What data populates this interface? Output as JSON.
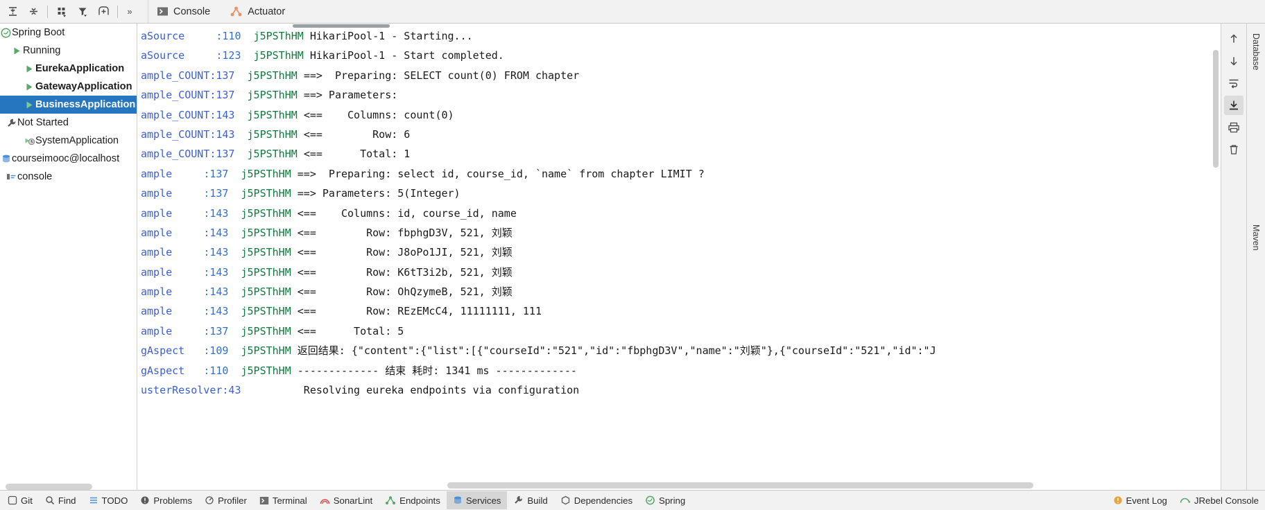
{
  "window": {
    "title": "Services"
  },
  "toolbar": {
    "buttons": [
      {
        "name": "expand-all-icon",
        "tooltip": "Expand All"
      },
      {
        "name": "collapse-all-icon",
        "tooltip": "Collapse All"
      },
      {
        "name": "group-by-icon",
        "tooltip": "Group By"
      },
      {
        "name": "filter-icon",
        "tooltip": "Filter"
      },
      {
        "name": "add-service-icon",
        "tooltip": "Add Service"
      }
    ],
    "more_label": "»"
  },
  "tabs": [
    {
      "label": "Console",
      "icon": "console-icon",
      "active": true
    },
    {
      "label": "Actuator",
      "icon": "actuator-icon",
      "active": false
    }
  ],
  "sidebar": {
    "items": [
      {
        "label": "Spring Boot",
        "indent": 0,
        "icon": "spring-boot-icon",
        "bold": false,
        "selected": false
      },
      {
        "label": "Running",
        "indent": 1,
        "icon": "run-arrow-icon",
        "bold": false,
        "selected": false
      },
      {
        "label": "EurekaApplication",
        "indent": 2,
        "icon": "run-arrow-icon",
        "bold": true,
        "selected": false
      },
      {
        "label": "GatewayApplication",
        "indent": 2,
        "icon": "run-arrow-icon",
        "bold": true,
        "selected": false
      },
      {
        "label": "BusinessApplication",
        "indent": 2,
        "icon": "run-arrow-icon",
        "bold": true,
        "selected": true
      },
      {
        "label": "Not Started",
        "indent": 1,
        "icon": "wrench-icon",
        "bold": false,
        "selected": false
      },
      {
        "label": "SystemApplication",
        "indent": 2,
        "icon": "not-started-icon",
        "bold": false,
        "selected": false
      },
      {
        "label": "courseimooc@localhost",
        "indent": 0,
        "icon": "database-icon",
        "bold": false,
        "selected": false
      },
      {
        "label": "console",
        "indent": 1,
        "icon": "db-console-icon",
        "bold": false,
        "selected": false
      }
    ]
  },
  "console": {
    "lines": [
      {
        "src": "aSource",
        "line": ":110",
        "thread": "j5PSThHM",
        "msg": "HikariPool-1 - Starting..."
      },
      {
        "src": "aSource",
        "line": ":123",
        "thread": "j5PSThHM",
        "msg": "HikariPool-1 - Start completed."
      },
      {
        "src": "ample_COUNT:137",
        "line": "",
        "thread": "j5PSThHM",
        "msg": "==>  Preparing: SELECT count(0) FROM chapter"
      },
      {
        "src": "ample_COUNT:137",
        "line": "",
        "thread": "j5PSThHM",
        "msg": "==> Parameters:"
      },
      {
        "src": "ample_COUNT:143",
        "line": "",
        "thread": "j5PSThHM",
        "msg": "<==    Columns: count(0)"
      },
      {
        "src": "ample_COUNT:143",
        "line": "",
        "thread": "j5PSThHM",
        "msg": "<==        Row: 6"
      },
      {
        "src": "ample_COUNT:137",
        "line": "",
        "thread": "j5PSThHM",
        "msg": "<==      Total: 1"
      },
      {
        "src": "ample",
        "line": ":137",
        "thread": "j5PSThHM",
        "msg": "==>  Preparing: select id, course_id, `name` from chapter LIMIT ?"
      },
      {
        "src": "ample",
        "line": ":137",
        "thread": "j5PSThHM",
        "msg": "==> Parameters: 5(Integer)"
      },
      {
        "src": "ample",
        "line": ":143",
        "thread": "j5PSThHM",
        "msg": "<==    Columns: id, course_id, name"
      },
      {
        "src": "ample",
        "line": ":143",
        "thread": "j5PSThHM",
        "msg": "<==        Row: fbphgD3V, 521, 刘颖"
      },
      {
        "src": "ample",
        "line": ":143",
        "thread": "j5PSThHM",
        "msg": "<==        Row: J8oPo1JI, 521, 刘颖"
      },
      {
        "src": "ample",
        "line": ":143",
        "thread": "j5PSThHM",
        "msg": "<==        Row: K6tT3i2b, 521, 刘颖"
      },
      {
        "src": "ample",
        "line": ":143",
        "thread": "j5PSThHM",
        "msg": "<==        Row: OhQzymeB, 521, 刘颖"
      },
      {
        "src": "ample",
        "line": ":143",
        "thread": "j5PSThHM",
        "msg": "<==        Row: REzEMcC4, 11111111, 111"
      },
      {
        "src": "ample",
        "line": ":137",
        "thread": "j5PSThHM",
        "msg": "<==      Total: 5"
      },
      {
        "src": "gAspect",
        "line": ":109",
        "thread": "j5PSThHM",
        "msg": "返回结果: {\"content\":{\"list\":[{\"courseId\":\"521\",\"id\":\"fbphgD3V\",\"name\":\"刘颖\"},{\"courseId\":\"521\",\"id\":\"J"
      },
      {
        "src": "gAspect",
        "line": ":110",
        "thread": "j5PSThHM",
        "msg": "------------- 结束 耗时: 1341 ms -------------"
      },
      {
        "src": "usterResolver:43",
        "line": "",
        "thread": "",
        "msg": "          Resolving eureka endpoints via configuration"
      }
    ]
  },
  "right_rail": {
    "buttons": [
      {
        "name": "scroll-up-icon",
        "tooltip": "Up the Stack Trace"
      },
      {
        "name": "scroll-down-icon",
        "tooltip": "Down the Stack Trace"
      },
      {
        "name": "soft-wrap-icon",
        "tooltip": "Soft-Wrap"
      },
      {
        "name": "scroll-to-end-icon",
        "tooltip": "Scroll to the End",
        "active": true
      },
      {
        "name": "print-icon",
        "tooltip": "Print"
      },
      {
        "name": "trash-icon",
        "tooltip": "Clear All"
      }
    ]
  },
  "far_right_tabs": [
    {
      "label": "Database"
    },
    {
      "label": "Maven"
    }
  ],
  "statusbar": {
    "items": [
      {
        "label": "Git",
        "icon": "git-icon",
        "active": false
      },
      {
        "label": "Find",
        "icon": "find-icon",
        "active": false
      },
      {
        "label": "TODO",
        "icon": "todo-icon",
        "active": false
      },
      {
        "label": "Problems",
        "icon": "problems-icon",
        "active": false
      },
      {
        "label": "Profiler",
        "icon": "profiler-icon",
        "active": false
      },
      {
        "label": "Terminal",
        "icon": "terminal-icon",
        "active": false
      },
      {
        "label": "SonarLint",
        "icon": "sonarlint-icon",
        "active": false
      },
      {
        "label": "Endpoints",
        "icon": "endpoints-icon",
        "active": false
      },
      {
        "label": "Services",
        "icon": "services-icon",
        "active": true
      },
      {
        "label": "Build",
        "icon": "build-icon",
        "active": false
      },
      {
        "label": "Dependencies",
        "icon": "dependencies-icon",
        "active": false
      },
      {
        "label": "Spring",
        "icon": "spring-icon",
        "active": false
      }
    ],
    "right_items": [
      {
        "label": "Event Log",
        "icon": "event-log-icon"
      },
      {
        "label": "JRebel Console",
        "icon": "jrebel-icon"
      }
    ]
  },
  "colors": {
    "selection": "#2675bf",
    "accent_green": "#59a869",
    "accent_orange": "#e8916b",
    "log_src": "#3b5fd6",
    "log_thread": "#0f7a3d"
  }
}
